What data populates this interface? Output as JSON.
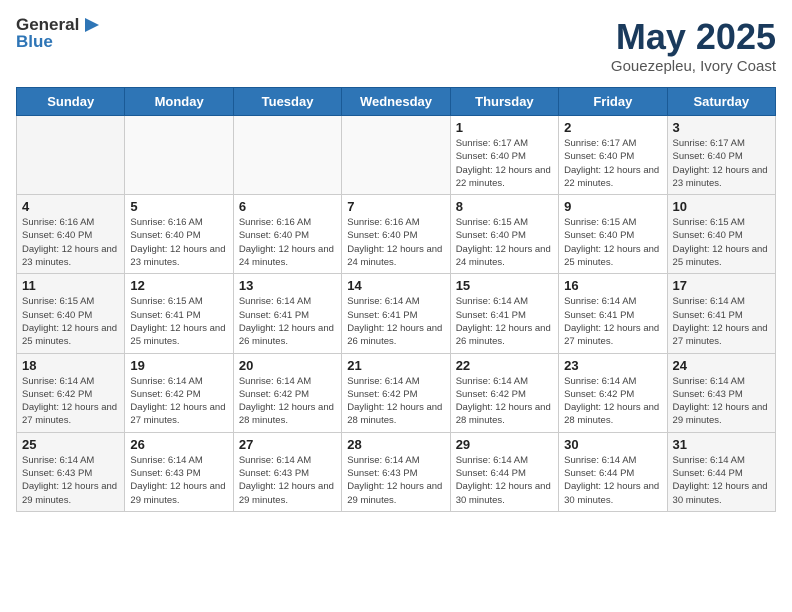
{
  "header": {
    "logo_general": "General",
    "logo_blue": "Blue",
    "month": "May 2025",
    "location": "Gouezepleu, Ivory Coast"
  },
  "weekdays": [
    "Sunday",
    "Monday",
    "Tuesday",
    "Wednesday",
    "Thursday",
    "Friday",
    "Saturday"
  ],
  "weeks": [
    [
      {
        "day": "",
        "sunrise": "",
        "sunset": "",
        "daylight": ""
      },
      {
        "day": "",
        "sunrise": "",
        "sunset": "",
        "daylight": ""
      },
      {
        "day": "",
        "sunrise": "",
        "sunset": "",
        "daylight": ""
      },
      {
        "day": "",
        "sunrise": "",
        "sunset": "",
        "daylight": ""
      },
      {
        "day": "1",
        "sunrise": "Sunrise: 6:17 AM",
        "sunset": "Sunset: 6:40 PM",
        "daylight": "Daylight: 12 hours and 22 minutes."
      },
      {
        "day": "2",
        "sunrise": "Sunrise: 6:17 AM",
        "sunset": "Sunset: 6:40 PM",
        "daylight": "Daylight: 12 hours and 22 minutes."
      },
      {
        "day": "3",
        "sunrise": "Sunrise: 6:17 AM",
        "sunset": "Sunset: 6:40 PM",
        "daylight": "Daylight: 12 hours and 23 minutes."
      }
    ],
    [
      {
        "day": "4",
        "sunrise": "Sunrise: 6:16 AM",
        "sunset": "Sunset: 6:40 PM",
        "daylight": "Daylight: 12 hours and 23 minutes."
      },
      {
        "day": "5",
        "sunrise": "Sunrise: 6:16 AM",
        "sunset": "Sunset: 6:40 PM",
        "daylight": "Daylight: 12 hours and 23 minutes."
      },
      {
        "day": "6",
        "sunrise": "Sunrise: 6:16 AM",
        "sunset": "Sunset: 6:40 PM",
        "daylight": "Daylight: 12 hours and 24 minutes."
      },
      {
        "day": "7",
        "sunrise": "Sunrise: 6:16 AM",
        "sunset": "Sunset: 6:40 PM",
        "daylight": "Daylight: 12 hours and 24 minutes."
      },
      {
        "day": "8",
        "sunrise": "Sunrise: 6:15 AM",
        "sunset": "Sunset: 6:40 PM",
        "daylight": "Daylight: 12 hours and 24 minutes."
      },
      {
        "day": "9",
        "sunrise": "Sunrise: 6:15 AM",
        "sunset": "Sunset: 6:40 PM",
        "daylight": "Daylight: 12 hours and 25 minutes."
      },
      {
        "day": "10",
        "sunrise": "Sunrise: 6:15 AM",
        "sunset": "Sunset: 6:40 PM",
        "daylight": "Daylight: 12 hours and 25 minutes."
      }
    ],
    [
      {
        "day": "11",
        "sunrise": "Sunrise: 6:15 AM",
        "sunset": "Sunset: 6:40 PM",
        "daylight": "Daylight: 12 hours and 25 minutes."
      },
      {
        "day": "12",
        "sunrise": "Sunrise: 6:15 AM",
        "sunset": "Sunset: 6:41 PM",
        "daylight": "Daylight: 12 hours and 25 minutes."
      },
      {
        "day": "13",
        "sunrise": "Sunrise: 6:14 AM",
        "sunset": "Sunset: 6:41 PM",
        "daylight": "Daylight: 12 hours and 26 minutes."
      },
      {
        "day": "14",
        "sunrise": "Sunrise: 6:14 AM",
        "sunset": "Sunset: 6:41 PM",
        "daylight": "Daylight: 12 hours and 26 minutes."
      },
      {
        "day": "15",
        "sunrise": "Sunrise: 6:14 AM",
        "sunset": "Sunset: 6:41 PM",
        "daylight": "Daylight: 12 hours and 26 minutes."
      },
      {
        "day": "16",
        "sunrise": "Sunrise: 6:14 AM",
        "sunset": "Sunset: 6:41 PM",
        "daylight": "Daylight: 12 hours and 27 minutes."
      },
      {
        "day": "17",
        "sunrise": "Sunrise: 6:14 AM",
        "sunset": "Sunset: 6:41 PM",
        "daylight": "Daylight: 12 hours and 27 minutes."
      }
    ],
    [
      {
        "day": "18",
        "sunrise": "Sunrise: 6:14 AM",
        "sunset": "Sunset: 6:42 PM",
        "daylight": "Daylight: 12 hours and 27 minutes."
      },
      {
        "day": "19",
        "sunrise": "Sunrise: 6:14 AM",
        "sunset": "Sunset: 6:42 PM",
        "daylight": "Daylight: 12 hours and 27 minutes."
      },
      {
        "day": "20",
        "sunrise": "Sunrise: 6:14 AM",
        "sunset": "Sunset: 6:42 PM",
        "daylight": "Daylight: 12 hours and 28 minutes."
      },
      {
        "day": "21",
        "sunrise": "Sunrise: 6:14 AM",
        "sunset": "Sunset: 6:42 PM",
        "daylight": "Daylight: 12 hours and 28 minutes."
      },
      {
        "day": "22",
        "sunrise": "Sunrise: 6:14 AM",
        "sunset": "Sunset: 6:42 PM",
        "daylight": "Daylight: 12 hours and 28 minutes."
      },
      {
        "day": "23",
        "sunrise": "Sunrise: 6:14 AM",
        "sunset": "Sunset: 6:42 PM",
        "daylight": "Daylight: 12 hours and 28 minutes."
      },
      {
        "day": "24",
        "sunrise": "Sunrise: 6:14 AM",
        "sunset": "Sunset: 6:43 PM",
        "daylight": "Daylight: 12 hours and 29 minutes."
      }
    ],
    [
      {
        "day": "25",
        "sunrise": "Sunrise: 6:14 AM",
        "sunset": "Sunset: 6:43 PM",
        "daylight": "Daylight: 12 hours and 29 minutes."
      },
      {
        "day": "26",
        "sunrise": "Sunrise: 6:14 AM",
        "sunset": "Sunset: 6:43 PM",
        "daylight": "Daylight: 12 hours and 29 minutes."
      },
      {
        "day": "27",
        "sunrise": "Sunrise: 6:14 AM",
        "sunset": "Sunset: 6:43 PM",
        "daylight": "Daylight: 12 hours and 29 minutes."
      },
      {
        "day": "28",
        "sunrise": "Sunrise: 6:14 AM",
        "sunset": "Sunset: 6:43 PM",
        "daylight": "Daylight: 12 hours and 29 minutes."
      },
      {
        "day": "29",
        "sunrise": "Sunrise: 6:14 AM",
        "sunset": "Sunset: 6:44 PM",
        "daylight": "Daylight: 12 hours and 30 minutes."
      },
      {
        "day": "30",
        "sunrise": "Sunrise: 6:14 AM",
        "sunset": "Sunset: 6:44 PM",
        "daylight": "Daylight: 12 hours and 30 minutes."
      },
      {
        "day": "31",
        "sunrise": "Sunrise: 6:14 AM",
        "sunset": "Sunset: 6:44 PM",
        "daylight": "Daylight: 12 hours and 30 minutes."
      }
    ]
  ]
}
